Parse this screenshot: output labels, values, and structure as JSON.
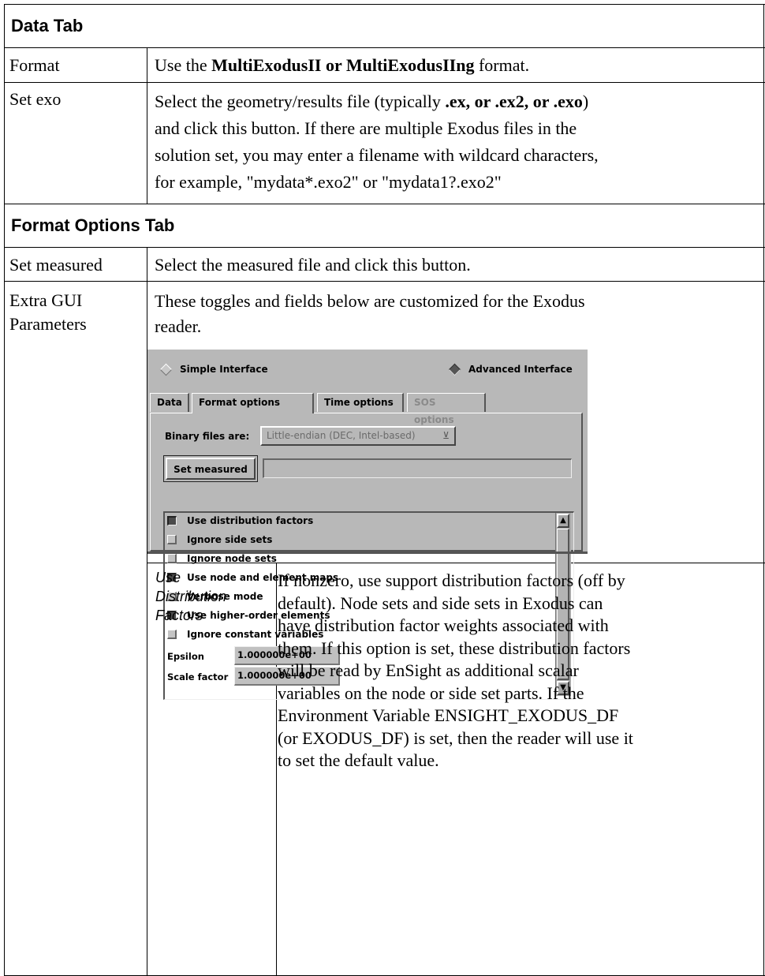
{
  "sections": {
    "data_tab": "Data Tab",
    "format_options_tab": "Format Options Tab"
  },
  "rows": {
    "format": {
      "label": "Format",
      "pre": "Use the ",
      "bold": "MultiExodusII or MultiExodusIIng",
      "post": " format."
    },
    "set_exo": {
      "label": "Set exo",
      "line1_pre": "Select the geometry/results file (typically ",
      "line1_bold": ".ex, or .ex2, or .exo",
      "line1_post": ")",
      "line2": "and click this button. If there are multiple Exodus files in the",
      "line3": "solution set, you may enter a filename with wildcard characters,",
      "line4": "for example, \"mydata*.exo2\" or \"mydata1?.exo2\""
    },
    "set_measured": {
      "label": "Set measured",
      "text": "Select the measured file and click this button."
    },
    "extra_gui": {
      "label_line1": "Extra GUI",
      "label_line2": "Parameters",
      "line1": "These toggles and fields below are customized for the Exodus",
      "line2": "reader."
    }
  },
  "panel": {
    "simple_interface": "Simple Interface",
    "advanced_interface": "Advanced Interface",
    "interface_mode": "Advanced Interface",
    "tabs": [
      "Data",
      "Format options",
      "Time options",
      "SOS options"
    ],
    "active_tab": "Format options",
    "binary_label": "Binary files are:",
    "binary_value": "Little-endian (DEC, Intel-based)",
    "set_measured_button": "Set measured",
    "measured_path": "",
    "toggles": [
      {
        "label": "Use distribution factors",
        "checked": true
      },
      {
        "label": "Ignore side sets",
        "checked": false
      },
      {
        "label": "Ignore node sets",
        "checked": false
      },
      {
        "label": "Use node and element maps",
        "checked": true
      },
      {
        "label": "Verbose mode",
        "checked": false
      },
      {
        "label": "Use higher-order elements",
        "checked": true
      },
      {
        "label": "Ignore constant variables",
        "checked": false
      }
    ],
    "epsilon_label": "Epsilon",
    "epsilon_value": "1.000000e+00",
    "scale_label": "Scale factor",
    "scale_value": "1.000000e+00"
  },
  "nested": {
    "term_line1": "Use",
    "term_line2": "Distribution",
    "term_line3": "Factors",
    "desc": [
      "If nonzero, use support distribution factors (off by",
      "default). Node sets and side sets in Exodus can",
      "have distribution factor weights associated with",
      "them. If this option is set, these distribution factors",
      "will be read by EnSight as additional scalar",
      "variables on the node or side set parts. If the",
      "Environment Variable ENSIGHT_EXODUS_DF",
      "(or EXODUS_DF) is set, then the reader will use it",
      "to set the default value."
    ]
  }
}
